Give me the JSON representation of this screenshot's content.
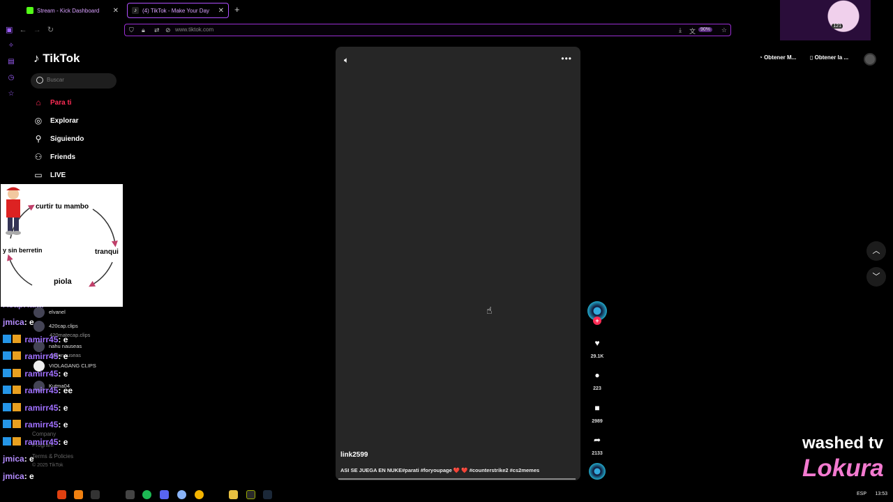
{
  "browser": {
    "tabs": [
      {
        "label": "Stream - Kick Dashboard",
        "close": "✕"
      },
      {
        "label": "(4) TikTok - Make Your Day",
        "close": "✕"
      }
    ],
    "new_tab": "+",
    "url": "www.tiktok.com",
    "zoom": "90%",
    "badge_count": "121"
  },
  "tiktok": {
    "logo": "TikTok",
    "search_placeholder": "Buscar",
    "nav": [
      {
        "label": "Para ti",
        "icon": "home-icon"
      },
      {
        "label": "Explorar",
        "icon": "compass-icon"
      },
      {
        "label": "Siguiendo",
        "icon": "following-icon"
      },
      {
        "label": "Friends",
        "icon": "friends-icon"
      },
      {
        "label": "LIVE",
        "icon": "live-icon"
      }
    ],
    "following": [
      {
        "name": "elvanel"
      },
      {
        "name": "420cap.clips",
        "handle": "420matecap.clips"
      },
      {
        "name": "nahu nauseas",
        "handle": "nahunauseas"
      },
      {
        "name": "VIOLAGANG CLIPS",
        "handle": "..."
      },
      {
        "name": "Kutma04"
      }
    ],
    "footer": {
      "company": "Company",
      "program": "Program",
      "terms": "Terms & Policies",
      "copyright": "© 2025 TikTok"
    },
    "top_right": {
      "btn1": "Obtener M...",
      "btn2": "Obtener la ..."
    },
    "video": {
      "author": "link2599",
      "caption": "ASI SE JUEGA EN NUKE#parati #foryoupage ❤️ ❤️ #counterstrike2 #cs2memes"
    },
    "actions": {
      "likes": "29.1K",
      "comments": "223",
      "saves": "2989",
      "shares": "2133"
    }
  },
  "meme": {
    "top": "curtir tu mambo",
    "right": "tranqui",
    "bottom": "piola",
    "left": "y sin berretin"
  },
  "chat": [
    {
      "user": "AsapRami",
      "msg": ""
    },
    {
      "user": "jmica",
      "msg": ": e",
      "badges": false
    },
    {
      "user": "ramirr45",
      "msg": ": e",
      "badges": true
    },
    {
      "user": "ramirr45",
      "msg": ": e",
      "badges": true
    },
    {
      "user": "ramirr45",
      "msg": ": e",
      "badges": true
    },
    {
      "user": "ramirr45",
      "msg": ": ee",
      "badges": true
    },
    {
      "user": "ramirr45",
      "msg": ": e",
      "badges": true
    },
    {
      "user": "ramirr45",
      "msg": ": e",
      "badges": true
    },
    {
      "user": "ramirr45",
      "msg": ": e",
      "badges": true
    },
    {
      "user": "jmica",
      "msg": ": e",
      "badges": false
    },
    {
      "user": "jmica",
      "msg": ": e",
      "badges": false
    },
    {
      "user": "jmica",
      "msg": ": e",
      "badges": false
    }
  ],
  "watermark": {
    "line1": "washed tv",
    "line2": "Lokura"
  },
  "taskbar": {
    "lang": "ESP",
    "time": "13:53"
  }
}
